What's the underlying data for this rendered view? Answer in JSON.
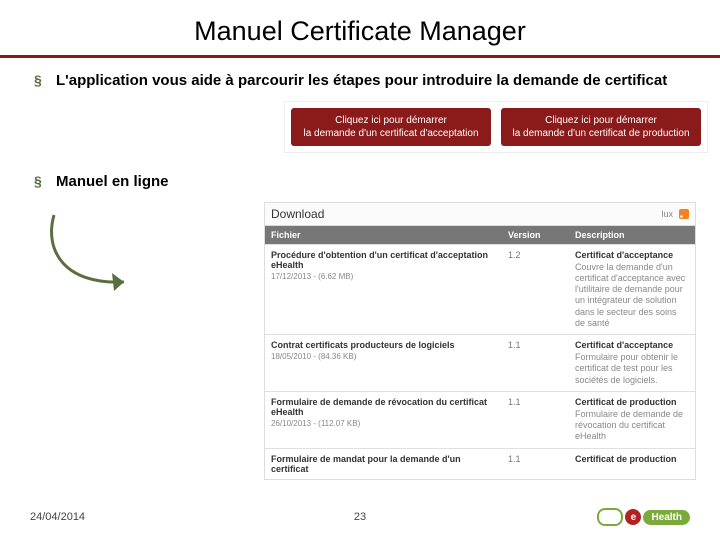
{
  "title": "Manuel Certificate Manager",
  "bullets": {
    "b1": "L'application vous aide à parcourir les étapes pour introduire la demande de certificat",
    "b2": "Manuel en ligne"
  },
  "cta": {
    "left_line1": "Cliquez ici pour démarrer",
    "left_line2": "la demande d'un certificat d'acceptation",
    "right_line1": "Cliquez ici pour démarrer",
    "right_line2": "la demande d'un certificat de production"
  },
  "download": {
    "tab": "Download",
    "lang": "lux",
    "headers": {
      "file": "Fichier",
      "version": "Version",
      "desc": "Description"
    },
    "rows": [
      {
        "title": "Procédure d'obtention d'un certificat d'acceptation eHealth",
        "meta": "17/12/2013 - (6.62 MB)",
        "version": "1.2",
        "desc_title": "Certificat d'acceptance",
        "desc_body": "Couvre la demande d'un certificat d'acceptance avec l'utilitaire de demande pour un intégrateur de solution dans le secteur des soins de santé"
      },
      {
        "title": "Contrat certificats producteurs de logiciels",
        "meta": "18/05/2010 - (84.36 KB)",
        "version": "1.1",
        "desc_title": "Certificat d'acceptance",
        "desc_body": "Formulaire pour obtenir le certificat de test pour les sociétés de logiciels."
      },
      {
        "title": "Formulaire de demande de révocation du certificat eHealth",
        "meta": "26/10/2013 - (112.07 KB)",
        "version": "1.1",
        "desc_title": "Certificat de production",
        "desc_body": "Formulaire de demande de révocation du certificat eHealth"
      },
      {
        "title": "Formulaire de mandat pour la demande d'un certificat",
        "meta": "",
        "version": "1.1",
        "desc_title": "Certificat de production",
        "desc_body": ""
      }
    ]
  },
  "footer": {
    "date": "24/04/2014",
    "page": "23"
  },
  "logo": {
    "e": "e",
    "health": "Health"
  }
}
